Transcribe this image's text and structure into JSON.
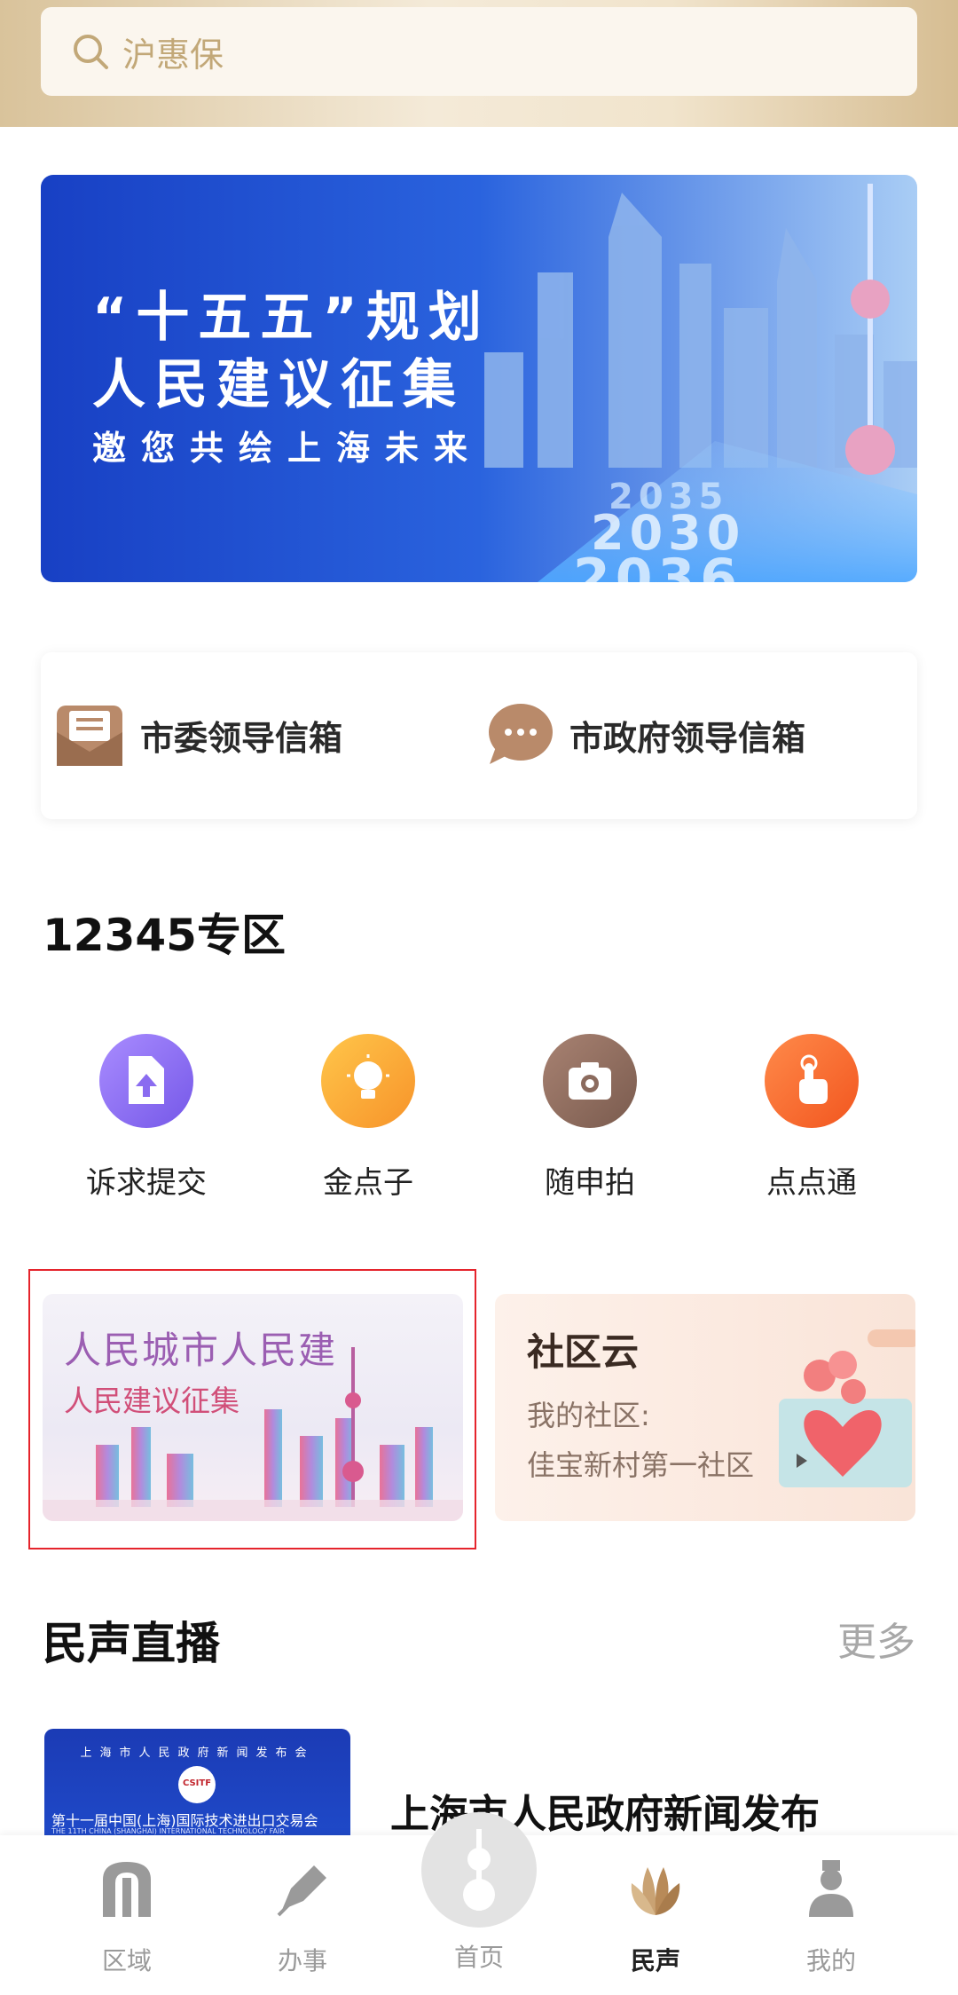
{
  "search": {
    "placeholder": "沪惠保"
  },
  "banner": {
    "line1": "“十五五”规划",
    "line2": "人民建议征集",
    "line3": "邀您共绘上海未来",
    "years": [
      "2035",
      "2030",
      "2036"
    ]
  },
  "mailbox": {
    "items": [
      {
        "label": "市委领导信箱",
        "icon": "envelope-icon"
      },
      {
        "label": "市政府领导信箱",
        "icon": "chat-bubble-icon"
      }
    ]
  },
  "zone": {
    "title": "12345专区",
    "items": [
      {
        "label": "诉求提交",
        "icon": "file-upload-icon",
        "color": "#8a6cf0"
      },
      {
        "label": "金点子",
        "icon": "lightbulb-icon",
        "color": "#f7a623"
      },
      {
        "label": "随申拍",
        "icon": "camera-icon",
        "color": "#8b6b5e"
      },
      {
        "label": "点点通",
        "icon": "tap-hand-icon",
        "color": "#f5662c"
      }
    ]
  },
  "promo": {
    "left_title": "人民城市人民建",
    "left_subtitle": "人民建议征集",
    "right_title": "社区云",
    "right_line1": "我的社区:",
    "right_line2": "佳宝新村第一社区"
  },
  "live": {
    "title": "民声直播",
    "more": "更多",
    "news_thumb_header": "上海市人民政府新闻发布会",
    "news_thumb_logo": "CSITF",
    "news_thumb_caption": "第十一届中国(上海)国际技术进出口交易会",
    "news_thumb_caption_en": "THE 11TH CHINA (SHANGHAI) INTERNATIONAL TECHNOLOGY FAIR",
    "news_title": "上海市人民政府新闻发布"
  },
  "nav": {
    "items": [
      {
        "label": "区域",
        "icon": "region-icon"
      },
      {
        "label": "办事",
        "icon": "pen-icon"
      },
      {
        "label": "首页",
        "icon": "tower-icon"
      },
      {
        "label": "民声",
        "icon": "magnolia-icon",
        "active": true
      },
      {
        "label": "我的",
        "icon": "person-icon"
      }
    ]
  },
  "colors": {
    "gold": "#c2a878",
    "highlight_border": "#e5242c",
    "banner_blue": "#1f4fd1"
  }
}
